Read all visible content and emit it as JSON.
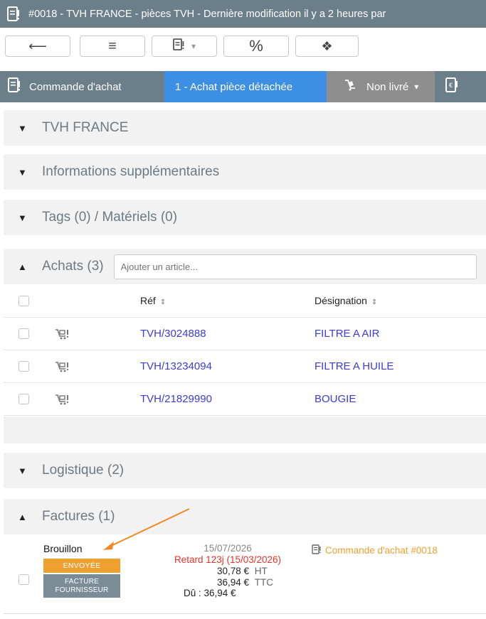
{
  "title_bar": {
    "text": "#0018   -   TVH FRANCE - pièces TVH   -   Dernière modification il y a 2 heures par"
  },
  "toolbar": {
    "back_glyph": "⟵",
    "list_glyph": "≡",
    "doc_dropdown_glyph": "▾",
    "percent_label": "%",
    "cube_glyph": "❖"
  },
  "tabs": [
    {
      "label": "Commande d'achat",
      "color": "#6b7f8a"
    },
    {
      "label": "1 - Achat pièce détachée",
      "color": "#3d8fe6"
    },
    {
      "label": "Non livré",
      "color": "#8e8e8e"
    }
  ],
  "tab_caret": "▾",
  "sections": {
    "supplier": {
      "label": "TVH FRANCE",
      "toggle": "▼"
    },
    "extra_info": {
      "label": "Informations supplémentaires",
      "toggle": "▼"
    },
    "tags": {
      "label": "Tags (0) / Matériels (0)",
      "toggle": "▼"
    },
    "purchases": {
      "label": "Achats (3)",
      "toggle": "▲",
      "add_placeholder": "Ajouter un article..."
    },
    "logistics": {
      "label": "Logistique (2)",
      "toggle": "▼"
    },
    "invoices": {
      "label": "Factures (1)",
      "toggle": "▲"
    }
  },
  "purchases_table": {
    "columns": {
      "ref": "Réf",
      "designation": "Désignation",
      "sort_glyph": "⇕"
    },
    "rows": [
      {
        "ref": "TVH/3024888",
        "designation": "FILTRE A AIR"
      },
      {
        "ref": "TVH/13234094",
        "designation": "FILTRE A HUILE"
      },
      {
        "ref": "TVH/21829990",
        "designation": "BOUGIE"
      }
    ]
  },
  "invoice": {
    "status": "Brouillon",
    "badge_sent": "ENVOYÉE",
    "badge_type_line1": "FACTURE",
    "badge_type_line2": "FOURNISSEUR",
    "date": "15/07/2026",
    "late": "Retard 123j (15/03/2026)",
    "amount_ht": "30,78 €",
    "ht_label": "HT",
    "amount_ttc": "36,94 €",
    "ttc_label": "TTC",
    "due": "Dû : 36,94 €",
    "linked_order": "Commande d'achat #0018"
  },
  "colors": {
    "header_bg": "#6b7f8a",
    "active_tab": "#3d8fe6",
    "link": "#3b3bd6",
    "orange": "#f0a030",
    "late_red": "#e8322b",
    "annotation_arrow": "#f08a24"
  }
}
